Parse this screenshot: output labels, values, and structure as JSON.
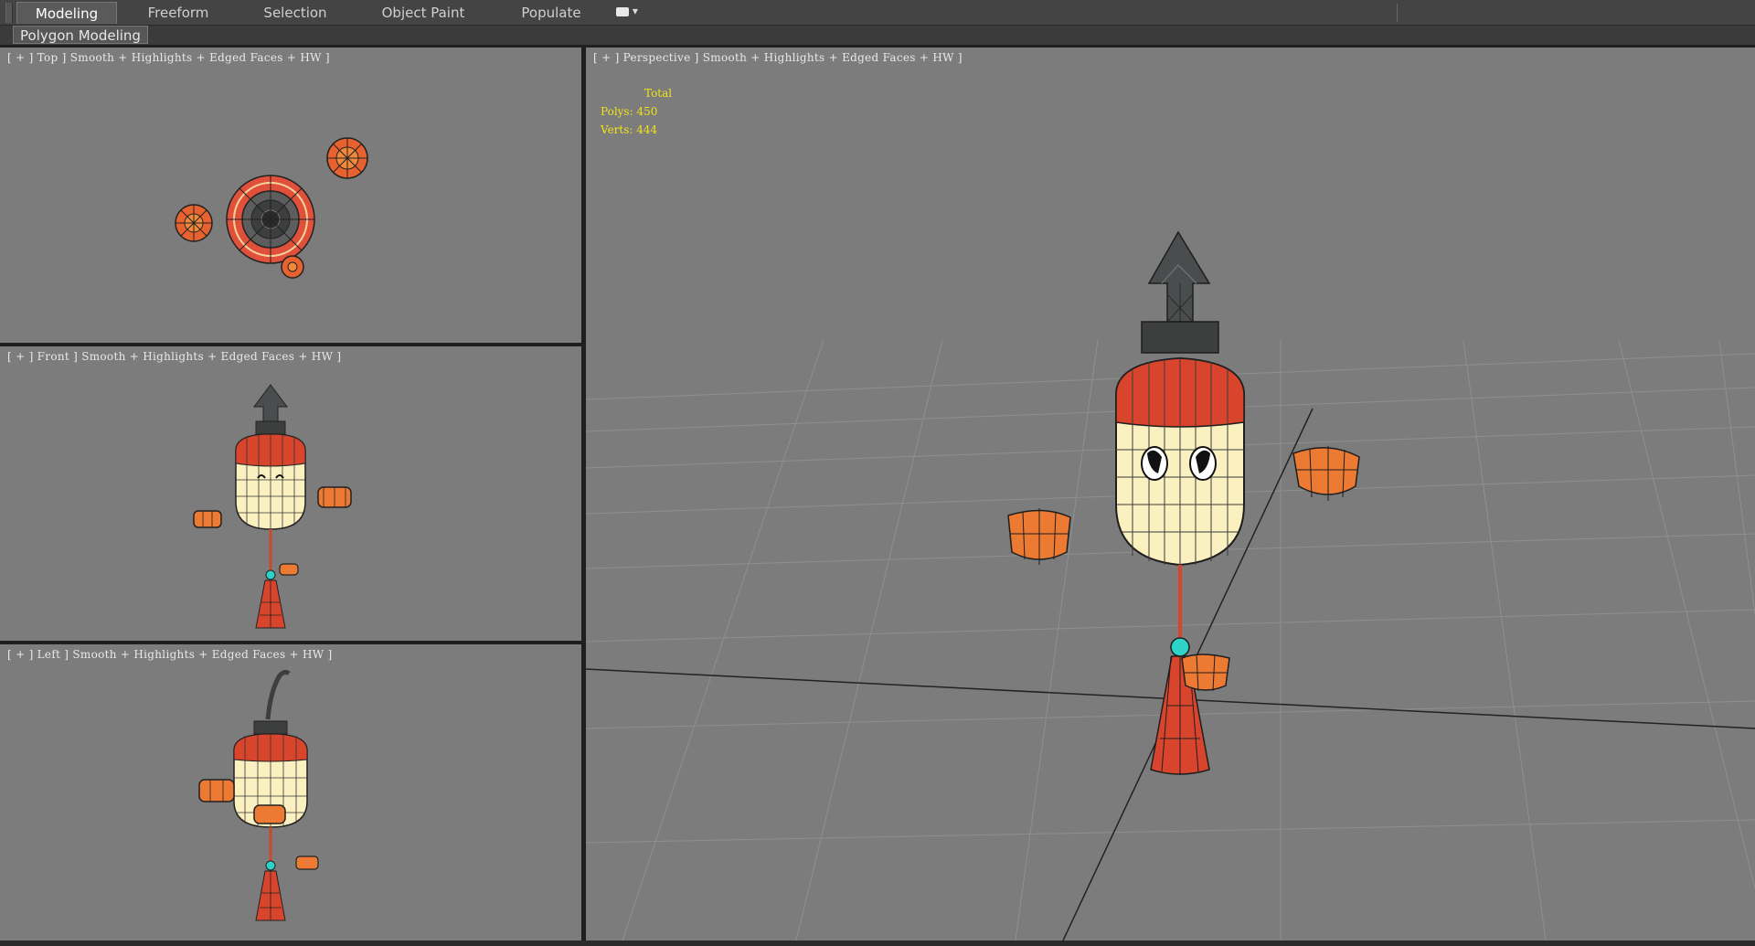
{
  "ribbon": {
    "tabs": [
      {
        "label": "Modeling",
        "active": true
      },
      {
        "label": "Freeform",
        "active": false
      },
      {
        "label": "Selection",
        "active": false
      },
      {
        "label": "Object Paint",
        "active": false
      },
      {
        "label": "Populate",
        "active": false
      }
    ],
    "dropdown_icon": "ribbon-options-icon",
    "subtab": "Polygon Modeling"
  },
  "viewports": {
    "top": {
      "label": "[ + ] Top ] Smooth + Highlights + Edged Faces + HW ]"
    },
    "front": {
      "label": "[ + ] Front ] Smooth + Highlights + Edged Faces + HW ]"
    },
    "left": {
      "label": "[ + ] Left ] Smooth + Highlights + Edged Faces + HW ]"
    },
    "perspective": {
      "label": "[ + ] Perspective ] Smooth + Highlights + Edged Faces + HW ]",
      "stats": {
        "heading": "Total",
        "polys": "Polys: 450",
        "verts": "Verts: 444"
      }
    }
  },
  "colors": {
    "viewport_bg": "#7c7c7c",
    "lantern_red": "#d9452c",
    "lantern_glow": "#fbf0c0",
    "roof_gray": "#4a4d4d",
    "stats_yellow": "#f2e21a",
    "gem_cyan": "#2ed3c8"
  }
}
